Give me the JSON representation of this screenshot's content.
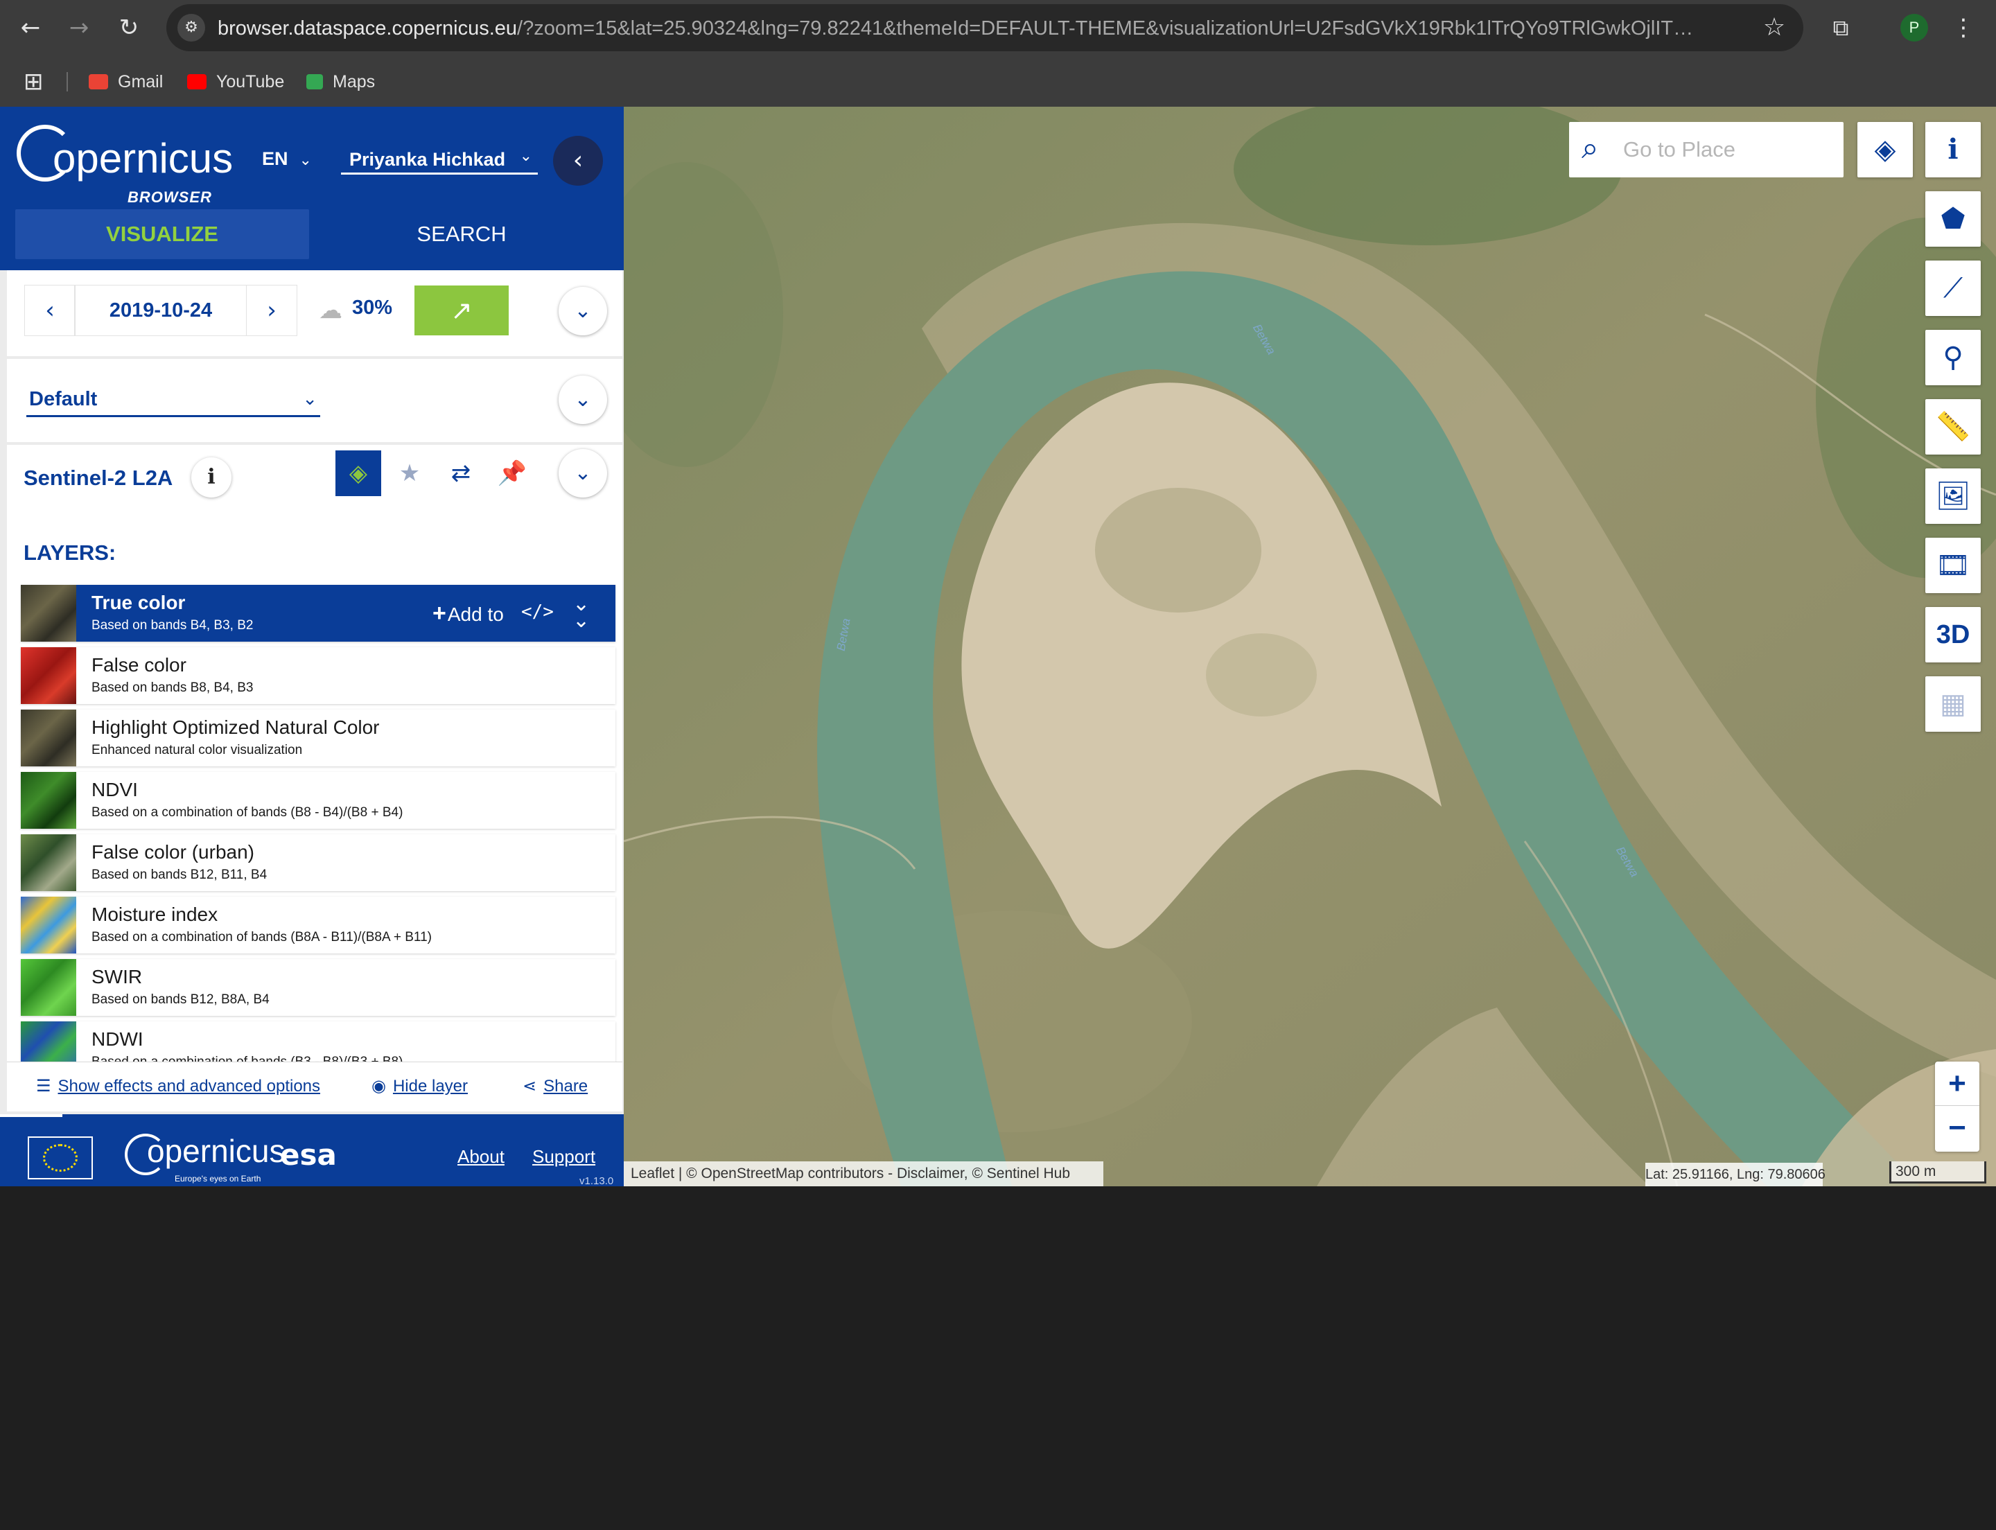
{
  "browser": {
    "url_host": "browser.dataspace.copernicus.eu",
    "url_rest": "/?zoom=15&lat=25.90324&lng=79.82241&themeId=DEFAULT-THEME&visualizationUrl=U2FsdGVkX19Rbk1lTrQYo9TRlGwkOjlITDot...",
    "profile_initial": "P",
    "bookmarks": [
      {
        "label": "Gmail",
        "color": "#ea4335"
      },
      {
        "label": "YouTube",
        "color": "#ff0000"
      },
      {
        "label": "Maps",
        "color": "#34a853"
      }
    ]
  },
  "panel": {
    "logo_text": "opernicus",
    "logo_sub": "BROWSER",
    "language": "EN",
    "user": "Priyanka Hichkad",
    "tabs": {
      "visualize": "VISUALIZE",
      "search": "SEARCH"
    },
    "date": "2019-10-24",
    "cloud_coverage": "30%",
    "theme": "Default",
    "dataset": "Sentinel-2 L2A",
    "layers_title": "LAYERS:",
    "layers": [
      {
        "name": "True color",
        "desc": "Based on bands B4, B3, B2",
        "active": true,
        "thumb": "true"
      },
      {
        "name": "False color",
        "desc": "Based on bands B8, B4, B3",
        "active": false,
        "thumb": "false"
      },
      {
        "name": "Highlight Optimized Natural Color",
        "desc": "Enhanced natural color visualization",
        "active": false,
        "thumb": "true"
      },
      {
        "name": "NDVI",
        "desc": "Based on a combination of bands (B8 - B4)/(B8 + B4)",
        "active": false,
        "thumb": "ndvi"
      },
      {
        "name": "False color (urban)",
        "desc": "Based on bands B12, B11, B4",
        "active": false,
        "thumb": "urban"
      },
      {
        "name": "Moisture index",
        "desc": "Based on a combination of bands (B8A - B11)/(B8A + B11)",
        "active": false,
        "thumb": "moisture"
      },
      {
        "name": "SWIR",
        "desc": "Based on bands B12, B8A, B4",
        "active": false,
        "thumb": "swir"
      },
      {
        "name": "NDWI",
        "desc": "Based on a combination of bands (B3 - B8)/(B3 + B8)",
        "active": false,
        "thumb": "ndwi"
      }
    ],
    "active_layer_actions": {
      "add_to": "Add to"
    },
    "bottom_links": {
      "effects": "Show effects and advanced options",
      "hide": "Hide layer",
      "share": "Share"
    },
    "footer": {
      "copernicus": "opernicus",
      "copernicus_sub": "Europe's eyes on Earth",
      "esa": "esa",
      "about": "About",
      "support": "Support",
      "version": "v1.13.0"
    }
  },
  "map": {
    "search_placeholder": "Go to Place",
    "tools": [
      {
        "icon": "info-icon"
      },
      {
        "icon": "polygon-icon"
      },
      {
        "icon": "line-icon"
      },
      {
        "icon": "pin-icon"
      },
      {
        "icon": "ruler-icon"
      },
      {
        "icon": "image-download-icon"
      },
      {
        "icon": "film-icon"
      },
      {
        "label": "3D"
      },
      {
        "icon": "chart-icon"
      }
    ],
    "river_name": "Betwa",
    "attribution": "Leaflet | © OpenStreetMap contributors - Disclaimer, © Sentinel Hub",
    "coordinates": "Lat: 25.91166, Lng: 79.80606",
    "scale": "300 m",
    "zoom_in": "+",
    "zoom_out": "−"
  },
  "colors": {
    "brand_blue": "#0a3d98",
    "accent_green": "#8cc63f",
    "river": "#6e9a84",
    "sand": "#cbbc9e",
    "land": "#8f9068"
  }
}
